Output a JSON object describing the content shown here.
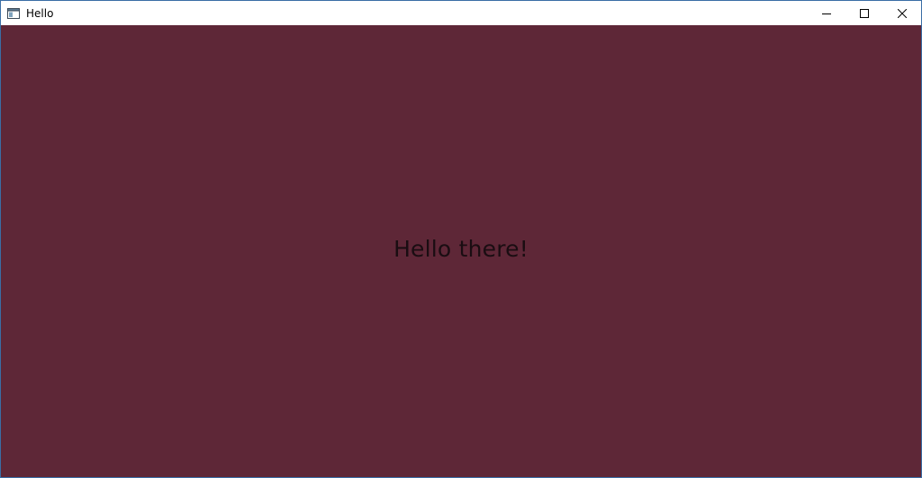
{
  "window": {
    "title": "Hello",
    "app_icon": "window-app-icon",
    "controls": {
      "minimize_icon": "minimize-icon",
      "maximize_icon": "maximize-icon",
      "close_icon": "close-icon"
    }
  },
  "content": {
    "message": "Hello there!",
    "background_color": "#5e2737",
    "text_color": "#1a0d12"
  }
}
